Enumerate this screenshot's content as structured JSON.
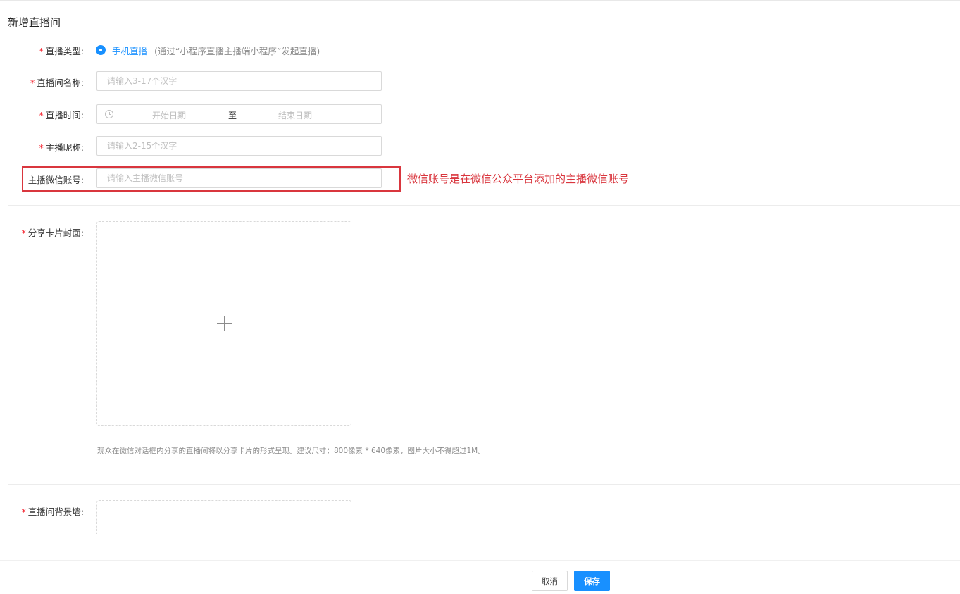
{
  "page": {
    "title": "新增直播间"
  },
  "form": {
    "live_type": {
      "required_mark": "*",
      "label": "直播类型:",
      "option_label": "手机直播",
      "option_hint": "(通过“小程序直播主播端小程序”发起直播)",
      "selected": true
    },
    "room_name": {
      "required_mark": "*",
      "label": "直播间名称:",
      "placeholder": "请输入3-17个汉字",
      "value": ""
    },
    "live_time": {
      "required_mark": "*",
      "label": "直播时间:",
      "start_placeholder": "开始日期",
      "separator": "至",
      "end_placeholder": "结束日期",
      "icon": "clock-icon"
    },
    "anchor_nickname": {
      "required_mark": "*",
      "label": "主播昵称:",
      "placeholder": "请输入2-15个汉字",
      "value": ""
    },
    "anchor_wechat": {
      "label": "主播微信账号:",
      "placeholder": "请输入主播微信账号",
      "value": ""
    },
    "share_cover": {
      "required_mark": "*",
      "label": "分享卡片封面:",
      "icon": "plus-icon",
      "helper": "观众在微信对话框内分享的直播间将以分享卡片的形式呈现。建议尺寸：800像素 * 640像素，图片大小不得超过1M。"
    },
    "background_wall": {
      "required_mark": "*",
      "label": "直播间背景墙:"
    }
  },
  "annotation": {
    "text": "微信账号是在微信公众平台添加的主播微信账号",
    "color": "#d9363e"
  },
  "footer": {
    "cancel_label": "取消",
    "save_label": "保存"
  },
  "colors": {
    "primary": "#1890ff",
    "required": "#f5222d",
    "annotation": "#d9363e"
  }
}
